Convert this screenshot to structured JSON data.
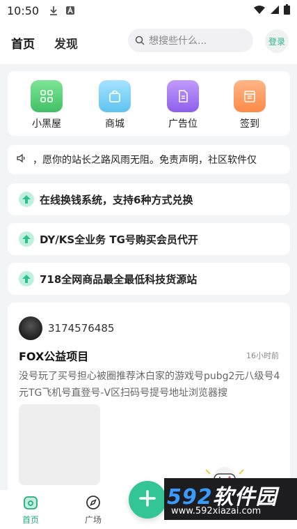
{
  "status_bar": {
    "time": "10:50",
    "icons": [
      "download-icon",
      "font-icon",
      "wifi-icon",
      "signal-icon",
      "battery-icon"
    ]
  },
  "header": {
    "tabs": [
      {
        "label": "首页",
        "active": true
      },
      {
        "label": "发现",
        "active": false
      }
    ],
    "search_placeholder": "想搜些什么...",
    "login_label": "登录"
  },
  "quick_actions": [
    {
      "label": "小黑屋",
      "icon": "grid-icon",
      "color": "#5fd37a"
    },
    {
      "label": "商城",
      "icon": "shopping-bag-icon",
      "color": "#7fd0f5"
    },
    {
      "label": "广告位",
      "icon": "document-icon",
      "color": "#a57cf3"
    },
    {
      "label": "签到",
      "icon": "calendar-icon",
      "color": "#ff9a5e"
    }
  ],
  "notice": {
    "icon": "speaker-icon",
    "text": "，愿你的站长之路风雨无阻。免责声明，社区软件仅"
  },
  "promos": [
    {
      "text": "在线换钱系统，支持6种方式兑换",
      "icon": "arrow-up-icon"
    },
    {
      "text": "DY/KS全业务 TG号购买会员代开",
      "icon": "arrow-up-icon"
    },
    {
      "text": "718全网商品最全最低科技货源站",
      "icon": "arrow-up-icon"
    }
  ],
  "post": {
    "username": "3174576485",
    "title": "FOX公益项目",
    "time": "16小时前",
    "body": "没号玩了买号担心被圈推荐沐白家的游戏号pubg2元八级号4元TG飞机号直登号-V区扫码号提号地址浏览器搜"
  },
  "bottom_nav": [
    {
      "label": "首页",
      "icon": "home-icon",
      "active": true
    },
    {
      "label": "广场",
      "icon": "compass-icon",
      "active": false
    }
  ],
  "fab_icon": "plus-icon",
  "watermark": {
    "num": "592",
    "text": "软件园",
    "url": "www.592xiazai.com"
  },
  "colors": {
    "accent": "#34c596",
    "background": "#f3f4f6"
  }
}
